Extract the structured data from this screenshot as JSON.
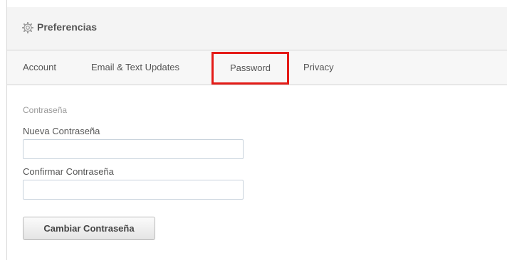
{
  "header": {
    "icon": "gear-icon",
    "title": "Preferencias"
  },
  "tabs": [
    {
      "label": "Account",
      "active": false
    },
    {
      "label": "Email & Text Updates",
      "active": false
    },
    {
      "label": "Password",
      "active": true,
      "highlighted": true
    },
    {
      "label": "Privacy",
      "active": false
    }
  ],
  "form": {
    "section_title": "Contraseña",
    "new_password_label": "Nueva Contraseña",
    "new_password_value": "",
    "confirm_password_label": "Confirmar Contraseña",
    "confirm_password_value": "",
    "submit_label": "Cambiar Contraseña"
  },
  "colors": {
    "highlight": "#e41b17",
    "header_bg": "#f4f4f4",
    "border": "#d4d4d4"
  }
}
